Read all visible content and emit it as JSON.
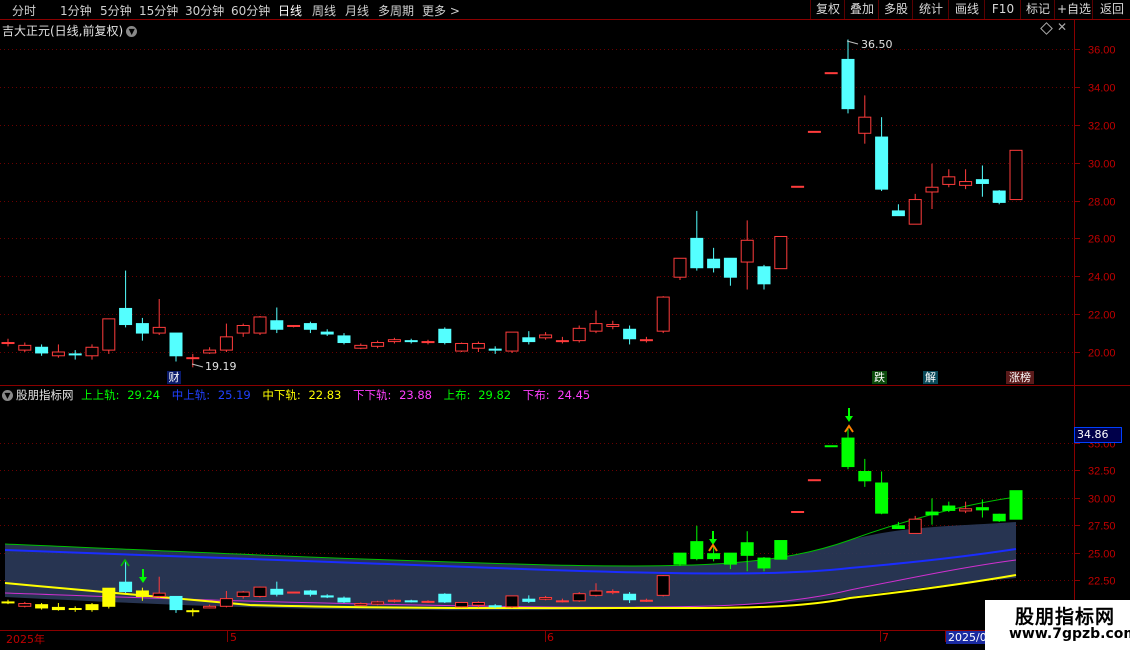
{
  "toolbar": {
    "periods": [
      "分时",
      "1分钟",
      "5分钟",
      "15分钟",
      "30分钟",
      "60分钟",
      "日线",
      "周线",
      "月线",
      "多周期",
      "更多 >"
    ],
    "active_period": "日线",
    "buttons": [
      "复权",
      "叠加",
      "多股",
      "统计",
      "画线",
      "F10",
      "标记",
      "+自选",
      "返回"
    ]
  },
  "main_chart": {
    "title": "吉大正元(日线,前复权)",
    "y_ticks": [
      "36.00",
      "34.00",
      "32.00",
      "30.00",
      "28.00",
      "26.00",
      "24.00",
      "22.00",
      "20.00"
    ],
    "high_label": "36.50",
    "low_label": "19.19",
    "markers": [
      "财",
      "跌",
      "解",
      "涨榜"
    ]
  },
  "indicator": {
    "name": "股朋指标网",
    "lines": [
      {
        "label": "上上轨:",
        "value": "29.24",
        "color": "#00ff00"
      },
      {
        "label": "中上轨:",
        "value": "25.19",
        "color": "#2040ff"
      },
      {
        "label": "中下轨:",
        "value": "22.83",
        "color": "#ffff00"
      },
      {
        "label": "下下轨:",
        "value": "23.88",
        "color": "#ff40ff"
      },
      {
        "label": "上布:",
        "value": "29.82",
        "color": "#00ff00"
      },
      {
        "label": "下布:",
        "value": "24.45",
        "color": "#ff40ff"
      }
    ],
    "y_ticks": [
      "35.00",
      "32.50",
      "30.00",
      "27.50",
      "25.00",
      "22.50"
    ],
    "current_price": "34.86"
  },
  "x_axis": {
    "labels": [
      "2025年",
      "5",
      "6",
      "7",
      "2025/0"
    ]
  },
  "logo": {
    "line1": "股朋指标网",
    "line2": "www.7gpzb.com"
  },
  "chart_data": {
    "type": "candlestick",
    "candles": [
      [
        20.45,
        20.5,
        20.7,
        20.3
      ],
      [
        20.1,
        20.35,
        20.5,
        20.0
      ],
      [
        20.25,
        19.95,
        20.4,
        19.8
      ],
      [
        19.8,
        20.0,
        20.4,
        19.7
      ],
      [
        19.9,
        19.85,
        20.1,
        19.6
      ],
      [
        19.8,
        20.25,
        20.4,
        19.6
      ],
      [
        20.1,
        21.75,
        21.75,
        19.9
      ],
      [
        22.3,
        21.45,
        24.3,
        21.3
      ],
      [
        21.5,
        21.0,
        21.8,
        20.6
      ],
      [
        21.0,
        21.3,
        22.8,
        20.9
      ],
      [
        21.0,
        19.8,
        21.0,
        19.5
      ],
      [
        19.7,
        19.7,
        19.9,
        19.19
      ],
      [
        19.95,
        20.1,
        20.25,
        19.9
      ],
      [
        20.1,
        20.8,
        21.5,
        20.0
      ],
      [
        21.0,
        21.4,
        21.5,
        20.8
      ],
      [
        21.0,
        21.85,
        21.9,
        20.9
      ],
      [
        21.65,
        21.2,
        22.35,
        21.0
      ],
      [
        21.35,
        21.4,
        21.4,
        21.3
      ],
      [
        21.5,
        21.2,
        21.6,
        21.0
      ],
      [
        21.05,
        20.95,
        21.2,
        20.85
      ],
      [
        20.85,
        20.5,
        21.0,
        20.4
      ],
      [
        20.2,
        20.35,
        20.45,
        20.15
      ],
      [
        20.3,
        20.5,
        20.6,
        20.2
      ],
      [
        20.55,
        20.65,
        20.75,
        20.45
      ],
      [
        20.6,
        20.55,
        20.7,
        20.45
      ],
      [
        20.55,
        20.55,
        20.65,
        20.4
      ],
      [
        21.2,
        20.5,
        21.3,
        20.4
      ],
      [
        20.05,
        20.45,
        20.5,
        20.0
      ],
      [
        20.2,
        20.45,
        20.55,
        20.0
      ],
      [
        20.15,
        20.1,
        20.3,
        19.9
      ],
      [
        20.05,
        21.05,
        21.05,
        19.95
      ],
      [
        20.75,
        20.55,
        21.1,
        20.4
      ],
      [
        20.75,
        20.9,
        21.05,
        20.65
      ],
      [
        20.6,
        20.6,
        20.8,
        20.45
      ],
      [
        20.6,
        21.25,
        21.4,
        20.5
      ],
      [
        21.1,
        21.5,
        22.2,
        21.0
      ],
      [
        21.35,
        21.45,
        21.65,
        21.2
      ],
      [
        21.2,
        20.7,
        21.4,
        20.4
      ],
      [
        20.65,
        20.65,
        20.8,
        20.5
      ],
      [
        21.1,
        22.9,
        22.95,
        21.0
      ],
      [
        23.95,
        24.95,
        24.95,
        23.8
      ],
      [
        26.0,
        24.45,
        27.45,
        24.3
      ],
      [
        24.9,
        24.45,
        25.5,
        24.2
      ],
      [
        24.95,
        23.95,
        24.95,
        23.5
      ],
      [
        24.75,
        25.9,
        26.95,
        23.3
      ],
      [
        24.5,
        23.6,
        24.6,
        23.3
      ],
      [
        24.4,
        26.1,
        26.1,
        24.4
      ],
      [
        28.75,
        28.75,
        28.75,
        28.75
      ],
      [
        31.65,
        31.65,
        31.65,
        31.65
      ],
      [
        34.75,
        34.75,
        34.75,
        34.75
      ],
      [
        35.45,
        32.85,
        36.5,
        32.6
      ],
      [
        31.55,
        32.4,
        33.55,
        31.0
      ],
      [
        31.35,
        28.6,
        32.4,
        28.5
      ],
      [
        27.45,
        27.2,
        27.8,
        27.2
      ],
      [
        26.75,
        28.05,
        28.35,
        26.75
      ],
      [
        28.45,
        28.7,
        29.95,
        27.55
      ],
      [
        28.85,
        29.25,
        29.65,
        28.7
      ],
      [
        28.8,
        29.0,
        29.65,
        28.6
      ],
      [
        29.1,
        28.9,
        29.85,
        28.2
      ],
      [
        28.5,
        27.9,
        28.55,
        27.8
      ],
      [
        28.05,
        30.65,
        30.65,
        28.05
      ]
    ]
  }
}
